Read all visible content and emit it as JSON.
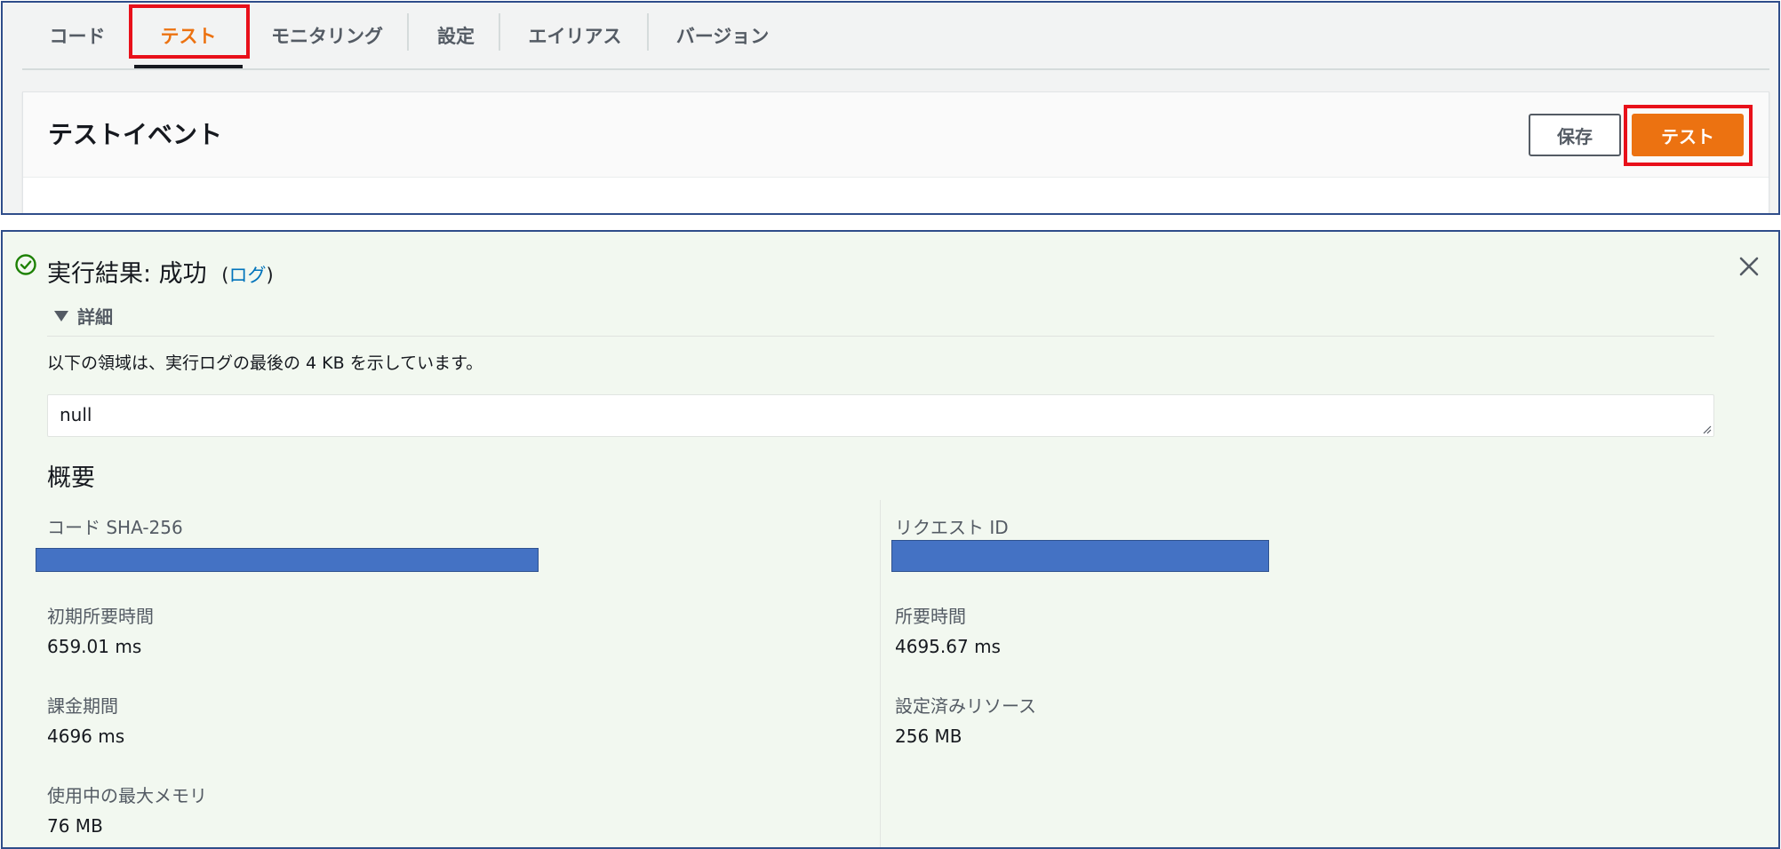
{
  "tabs": [
    {
      "label": "コード"
    },
    {
      "label": "テスト"
    },
    {
      "label": "モニタリング"
    },
    {
      "label": "設定"
    },
    {
      "label": "エイリアス"
    },
    {
      "label": "バージョン"
    }
  ],
  "active_tab": "テスト",
  "test_event": {
    "title": "テストイベント",
    "save_label": "保存",
    "test_label": "テスト"
  },
  "result": {
    "title": "実行結果: 成功",
    "paren_open": "(",
    "log_link": "ログ",
    "paren_close": ")",
    "details_label": "詳細",
    "info_text": "以下の領域は、実行ログの最後の 4 KB を示しています。",
    "log_output": "null",
    "summary_title": "概要",
    "summary": {
      "code_sha_label": "コード SHA-256",
      "request_id_label": "リクエスト ID",
      "init_duration_label": "初期所要時間",
      "init_duration_value": "659.01 ms",
      "duration_label": "所要時間",
      "duration_value": "4695.67 ms",
      "billed_duration_label": "課金期間",
      "billed_duration_value": "4696 ms",
      "configured_resources_label": "設定済みリソース",
      "configured_resources_value": "256 MB",
      "max_memory_label": "使用中の最大メモリ",
      "max_memory_value": "76 MB"
    }
  },
  "colors": {
    "accent_orange": "#ec7211",
    "success_green": "#1d8102",
    "link_blue": "#0073bb",
    "highlight_red": "#e8101a",
    "redaction_blue": "#4472c4"
  },
  "icons": {
    "success": "check-circle-icon",
    "close": "close-icon",
    "toggle": "caret-down-icon"
  }
}
